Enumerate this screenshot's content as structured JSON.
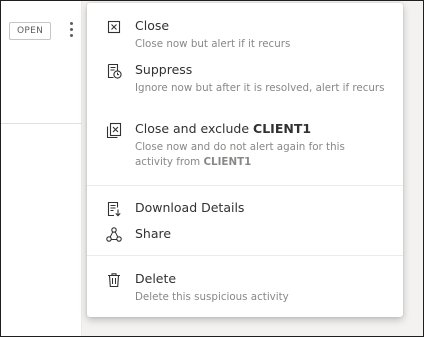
{
  "status_badge": "OPEN",
  "menu": {
    "close": {
      "title": "Close",
      "description": "Close now but alert if it recurs"
    },
    "suppress": {
      "title": "Suppress",
      "description": "Ignore now but after it is resolved, alert if recurs"
    },
    "close_exclude": {
      "title_prefix": "Close and exclude ",
      "title_entity": "CLIENT1",
      "description_prefix": "Close now and do not alert again for this activity from ",
      "description_entity": "CLIENT1"
    },
    "download": {
      "title": "Download Details"
    },
    "share": {
      "title": "Share"
    },
    "delete": {
      "title": "Delete",
      "description": "Delete this suspicious activity"
    }
  },
  "icons": {
    "close": "close-box-icon",
    "suppress": "document-clock-icon",
    "close_exclude": "close-exclude-icon",
    "download": "download-document-icon",
    "share": "share-nodes-icon",
    "delete": "trash-icon"
  },
  "colors": {
    "text_primary": "#323130",
    "text_secondary": "#8a8886",
    "panel_bg": "#f3f2f1",
    "separator": "#edebe9"
  }
}
